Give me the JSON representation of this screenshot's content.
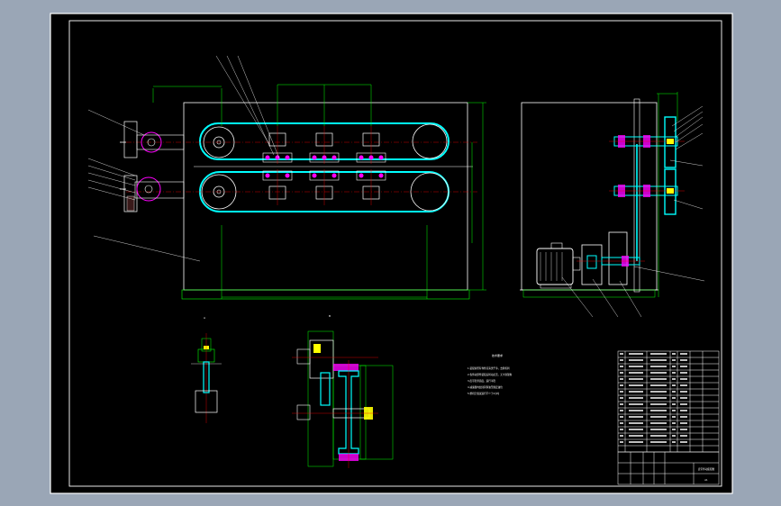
{
  "colors": {
    "viewport_bg": "#9aa6b6",
    "sheet_bg": "#000000",
    "frame": "#ffffff",
    "dimension": "#00ff00",
    "belt": "#00ffff",
    "body": "#ffffff",
    "magenta": "#ff00ff",
    "yellow": "#ffff00",
    "red": "#ff0000"
  },
  "drawing": {
    "section_marks": [
      "A",
      "B"
    ],
    "notes_heading": "技术要求",
    "notes_lines": [
      "1.装配前所有零件应清洗干净，去除毛刺",
      "2.各传动部件装配后转动灵活，无卡滞现象",
      "3.皮带张紧适度，运行平稳",
      "4.减速器内加注润滑油至规定油位",
      "5.整机空载试运行不少于2小时"
    ],
    "title_block": {
      "drawing_title": "皮带传动装配图",
      "sheet_label": "A1"
    }
  }
}
